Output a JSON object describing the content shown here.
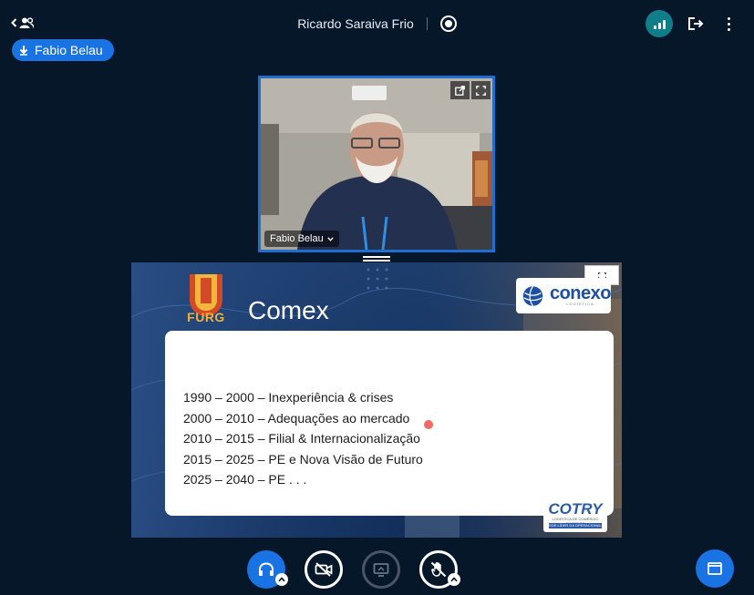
{
  "header": {
    "meeting_title": "Ricardo Saraiva Frio",
    "icons": [
      "chevron-left-icon",
      "users-icon",
      "record-icon",
      "connection-status-icon",
      "leave-icon",
      "more-vertical-icon"
    ],
    "connection_color": "#0f7e88"
  },
  "presenter": {
    "name": "Fabio Belau",
    "icon": "download-arrow-icon",
    "color": "#1a73e2"
  },
  "webcam": {
    "user_name": "Fabio Belau",
    "border_color": "#1f6fd0",
    "controls": [
      "popout-icon",
      "fullscreen-icon"
    ]
  },
  "slide": {
    "logo_text": "FURG",
    "title": "Comex",
    "partner_logo": "conexo",
    "partner_tagline": "LOGÍSTICA",
    "timeline": [
      "1990 – 2000 – Inexperiência & crises",
      "2000 – 2010 – Adequações ao mercado",
      "2010 – 2015 – Filial & Internacionalização",
      "2015 – 2025 – PE e Nova Visão de Futuro",
      "2025 – 2040 – PE  . . ."
    ],
    "footer_logo": "COTRY",
    "footer_tagline": "LOGÍSTICA DE COMÉRCIO EXTERIOR",
    "footer_badge": "EDE LÍDER DA OPERACIONAL",
    "pointer_color": "#f26a63"
  },
  "controls": {
    "audio": "headphones-icon",
    "video": "video-off-icon",
    "screen_share": "screen-share-icon",
    "raise_hand": "hand-off-icon",
    "layout": "layout-icon",
    "accent": "#1a73e2"
  }
}
